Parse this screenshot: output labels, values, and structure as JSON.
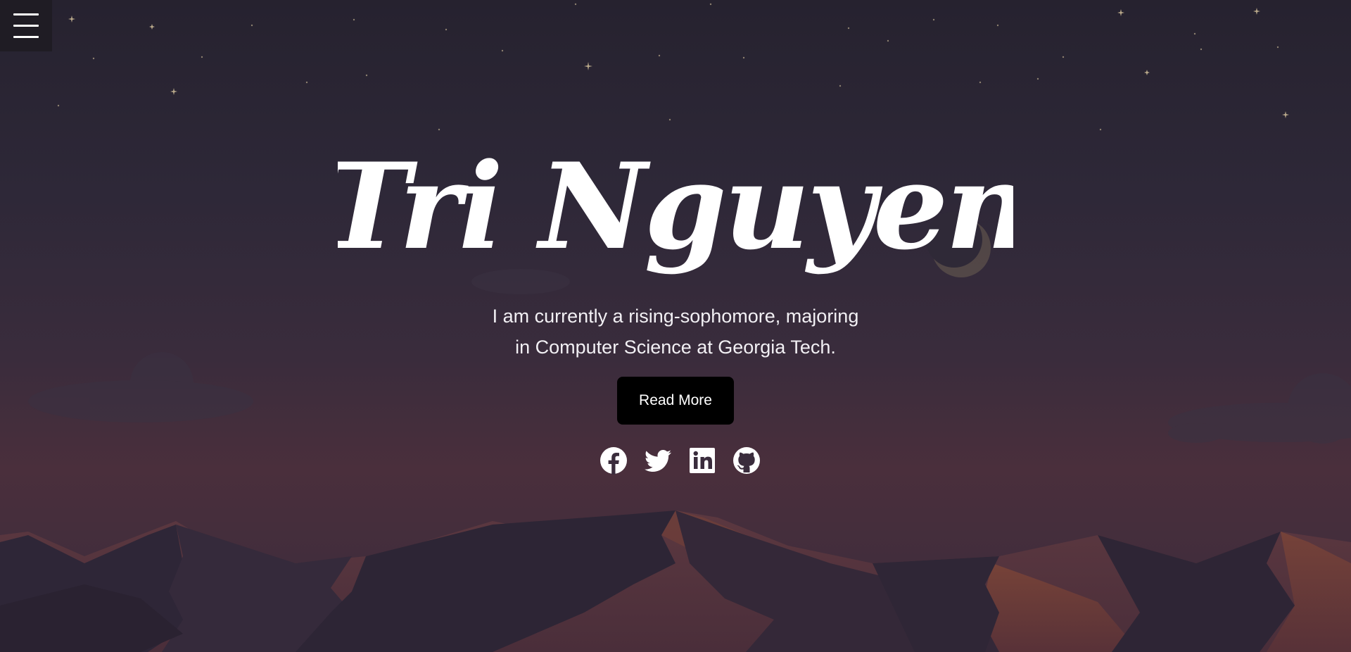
{
  "hero": {
    "name": "Tri Nguyen",
    "tagline_line1": "I am currently a rising-sophomore, majoring",
    "tagline_line2": "in Computer Science at Georgia Tech.",
    "button_label": "Read More"
  },
  "nav": {
    "menu_icon": "hamburger-menu-icon"
  },
  "socials": [
    {
      "icon": "facebook-icon"
    },
    {
      "icon": "twitter-icon"
    },
    {
      "icon": "linkedin-icon"
    },
    {
      "icon": "github-icon"
    }
  ],
  "colors": {
    "sky_top": "#26222f",
    "sky_bottom": "#4a2f3c",
    "text": "#ffffff",
    "button_bg": "#000000",
    "star": "#b8a88a",
    "moon": "#8a7a66"
  }
}
